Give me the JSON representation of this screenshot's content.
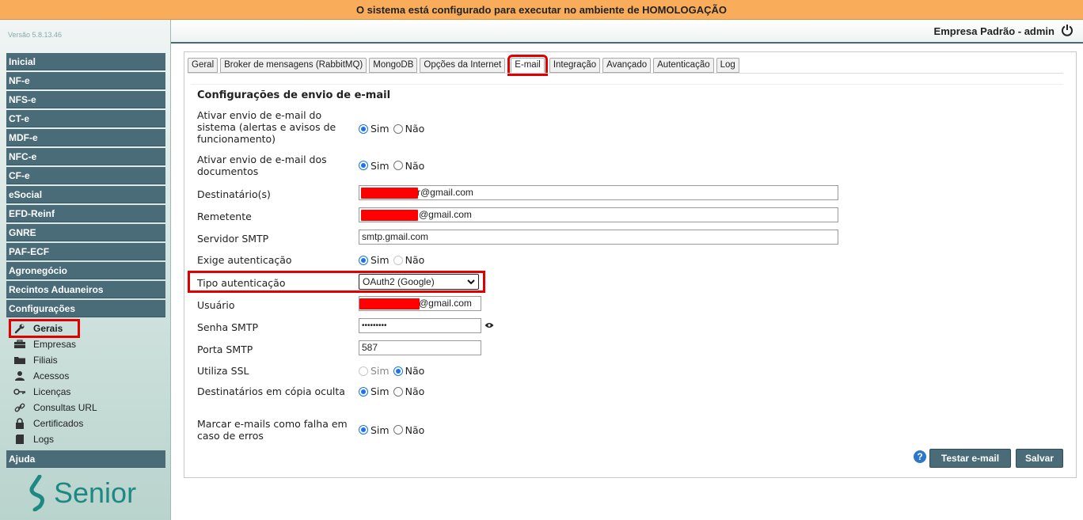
{
  "banner": {
    "text": "O sistema está configurado para executar no ambiente de HOMOLOGAÇÃO"
  },
  "sidebar": {
    "version": "Versão 5.8.13.46",
    "menu": [
      "Inicial",
      "NF-e",
      "NFS-e",
      "CT-e",
      "MDF-e",
      "NFC-e",
      "CF-e",
      "eSocial",
      "EFD-Reinf",
      "GNRE",
      "PAF-ECF",
      "Agronegócio",
      "Recintos Aduaneiros",
      "Configurações"
    ],
    "submenu": [
      {
        "label": "Gerais",
        "icon": "wrench-icon"
      },
      {
        "label": "Empresas",
        "icon": "briefcase-icon"
      },
      {
        "label": "Filiais",
        "icon": "folder-icon"
      },
      {
        "label": "Acessos",
        "icon": "user-icon"
      },
      {
        "label": "Licenças",
        "icon": "key-icon"
      },
      {
        "label": "Consultas URL",
        "icon": "link-icon"
      },
      {
        "label": "Certificados",
        "icon": "lock-icon"
      },
      {
        "label": "Logs",
        "icon": "book-icon"
      }
    ],
    "help": "Ajuda",
    "logo": "Senior"
  },
  "topbar": {
    "company": "Empresa Padrão - admin"
  },
  "tabs": [
    "Geral",
    "Broker de mensagens (RabbitMQ)",
    "MongoDB",
    "Opções da Internet",
    "E-mail",
    "Integração",
    "Avançado",
    "Autenticação",
    "Log"
  ],
  "active_tab": "E-mail",
  "form": {
    "title": "Configurações de envio de e-mail",
    "enable_system_label": "Ativar envio de e-mail do sistema (alertas e avisos de funcionamento)",
    "enable_docs_label": "Ativar envio de e-mail dos documentos",
    "recipients_label": "Destinatário(s)",
    "recipients_value": "r@gmail.com",
    "sender_label": "Remetente",
    "sender_value": "@gmail.com",
    "smtp_server_label": "Servidor SMTP",
    "smtp_server_value": "smtp.gmail.com",
    "require_auth_label": "Exige autenticação",
    "auth_type_label": "Tipo autenticação",
    "auth_type_value": "OAuth2 (Google)",
    "user_label": "Usuário",
    "user_value": "@gmail.com",
    "password_label": "Senha SMTP",
    "password_value": "•••••••••",
    "port_label": "Porta SMTP",
    "port_value": "587",
    "ssl_label": "Utiliza SSL",
    "cc_label": "Destinatários em cópia oculta",
    "fail_label": "Marcar e-mails como falha em caso de erros",
    "yes": "Sim",
    "no": "Não"
  },
  "buttons": {
    "test": "Testar e-mail",
    "save": "Salvar"
  },
  "colors": {
    "accent": "#4a6b78",
    "banner": "#f9ad5a",
    "highlight": "#e00000"
  }
}
